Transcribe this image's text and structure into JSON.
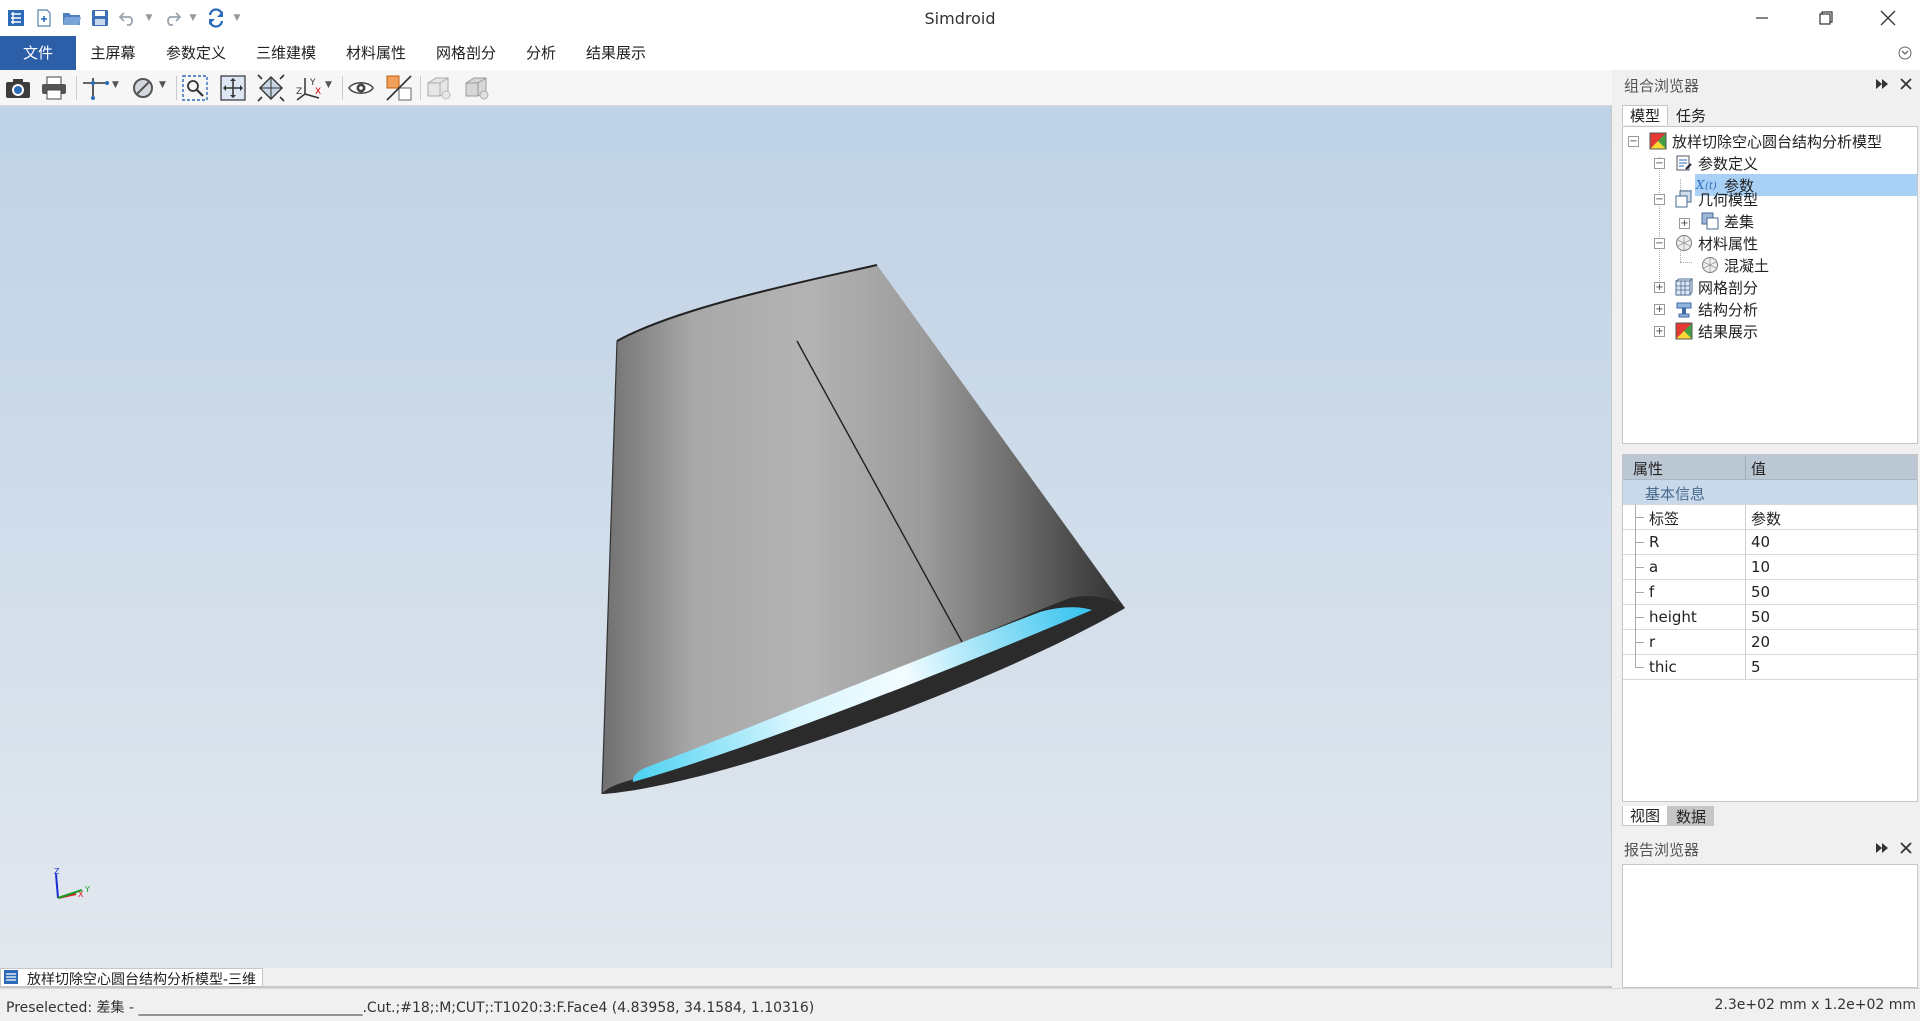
{
  "window": {
    "title": "Simdroid",
    "controls": {
      "minimize": "minimize",
      "maximize": "restore",
      "close": "close"
    }
  },
  "menu": {
    "items": [
      "文件",
      "主屏幕",
      "参数定义",
      "三维建模",
      "材料属性",
      "网格剖分",
      "分析",
      "结果展示"
    ],
    "active": "文件"
  },
  "colors": {
    "menu_active_bg": "#2d5fa8",
    "selection_bg": "#a9d1f6",
    "viewport_top": "#bfd2e6",
    "viewport_bottom": "#e3e8ee",
    "props_section_bg": "#c9d9ea"
  },
  "combo_browser": {
    "title": "组合浏览器",
    "tabs": [
      "模型",
      "任务"
    ],
    "active_tab": "模型",
    "tree": {
      "root": "放样切除空心圆台结构分析模型",
      "param_group": "参数定义",
      "param_item": "参数",
      "geometry_group": "几何模型",
      "geometry_item": "差集",
      "material_group": "材料属性",
      "material_item": "混凝土",
      "mesh_group": "网格剖分",
      "analysis_group": "结构分析",
      "results_group": "结果展示"
    },
    "selected": "参数"
  },
  "properties": {
    "header_key": "属性",
    "header_value": "值",
    "section": "基本信息",
    "rows": [
      {
        "key": "标签",
        "value": "参数"
      },
      {
        "key": "R",
        "value": "40"
      },
      {
        "key": "a",
        "value": "10"
      },
      {
        "key": "f",
        "value": "50"
      },
      {
        "key": "height",
        "value": "50"
      },
      {
        "key": "r",
        "value": "20"
      },
      {
        "key": "thic",
        "value": "5"
      }
    ]
  },
  "bottom_tabs": [
    "视图",
    "数据"
  ],
  "bottom_tab_active": "数据",
  "report_browser": {
    "title": "报告浏览器"
  },
  "viewport": {
    "document_tab": "放样切除空心圆台结构分析模型-三维",
    "axis_labels": {
      "x": "X",
      "y": "Y",
      "z": "Z"
    }
  },
  "status": {
    "left": "Preselected: 差集 - ________________________________.Cut.;#18;:M;CUT;:T1020:3:F.Face4 (4.83958, 34.1584, 1.10316)",
    "right": "2.3e+02 mm x 1.2e+02 mm"
  },
  "icons": {
    "app": "simdroid-logo-icon",
    "new": "new-file-icon",
    "open": "open-folder-icon",
    "save": "save-icon",
    "undo": "undo-icon",
    "redo": "redo-icon",
    "refresh": "refresh-icon",
    "camera": "camera-icon",
    "print": "print-icon",
    "axis": "axis-cross-icon",
    "noentry": "draw-style-icon",
    "fit_select": "fit-selection-icon",
    "fit_all": "fit-all-icon",
    "view_iso": "isometric-view-icon",
    "coord": "coordinate-system-icon",
    "eye": "eye-icon",
    "section": "section-plane-icon",
    "light1": "box-light-icon",
    "light2": "box-light-icon"
  }
}
